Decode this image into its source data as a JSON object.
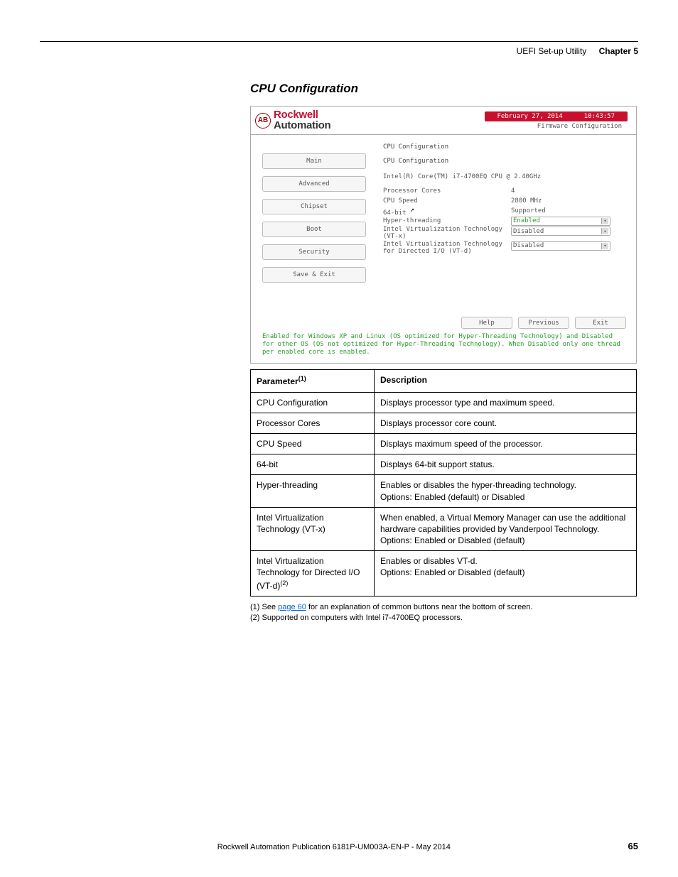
{
  "header": {
    "section": "UEFI Set-up Utility",
    "chapter": "Chapter 5"
  },
  "section_title": "CPU Configuration",
  "bios": {
    "brand1": "Rockwell",
    "brand2": "Automation",
    "date": "February 27, 2014",
    "time": "10:43:57",
    "firmware": "Firmware Configuration",
    "nav": [
      "Main",
      "Advanced",
      "Chipset",
      "Boot",
      "Security",
      "Save & Exit"
    ],
    "title": "CPU Configuration",
    "subtitle": "CPU Configuration",
    "cpu_line": "Intel(R) Core(TM) i7-4700EQ CPU @ 2.40GHz",
    "rows": [
      {
        "label": "Processor Cores",
        "value": "4"
      },
      {
        "label": "CPU Speed",
        "value": "2800 MHz"
      },
      {
        "label": "64-bit",
        "value": "Supported"
      }
    ],
    "dd": [
      {
        "label": "Hyper-threading",
        "value": "Enabled",
        "enabled": true
      },
      {
        "label": "Intel Virtualization Technology (VT-x)",
        "value": "Disabled",
        "enabled": false
      },
      {
        "label": "Intel Virtualization Technology for Directed I/O (VT-d)",
        "value": "Disabled",
        "enabled": false
      }
    ],
    "buttons": [
      "Help",
      "Previous",
      "Exit"
    ],
    "help": "Enabled for Windows XP and Linux (OS optimized for Hyper-Threading Technology) and Disabled for other OS (OS not optimized for Hyper-Threading Technology). When Disabled only one thread per enabled core is enabled."
  },
  "table": {
    "headers": [
      "Parameter",
      "Description"
    ],
    "header_sup": "(1)",
    "rows": [
      {
        "p": "CPU Configuration",
        "d": "Displays processor type and maximum speed."
      },
      {
        "p": "Processor Cores",
        "d": "Displays processor core count."
      },
      {
        "p": "CPU Speed",
        "d": "Displays maximum speed of the processor."
      },
      {
        "p": "64-bit",
        "d": "Displays 64-bit support status."
      },
      {
        "p": "Hyper-threading",
        "d": "Enables or disables the hyper-threading technology.\nOptions: Enabled (default) or Disabled"
      },
      {
        "p": "Intel Virtualization Technology (VT-x)",
        "d": "When enabled, a Virtual Memory Manager can use the additional hardware capabilities provided by Vanderpool Technology.\nOptions: Enabled or Disabled (default)"
      },
      {
        "p": "Intel Virtualization Technology for Directed I/O (VT-d)",
        "sup": "(2)",
        "d": "Enables or disables VT-d.\nOptions: Enabled or Disabled (default)"
      }
    ]
  },
  "footnotes": {
    "f1_pre": "(1)   See ",
    "f1_link": "page 60",
    "f1_post": " for an explanation of common buttons near the bottom of screen.",
    "f2": "(2)   Supported on computers with Intel i7-4700EQ processors."
  },
  "footer": {
    "publication": "Rockwell Automation Publication 6181P-UM003A-EN-P - May 2014",
    "page": "65"
  }
}
